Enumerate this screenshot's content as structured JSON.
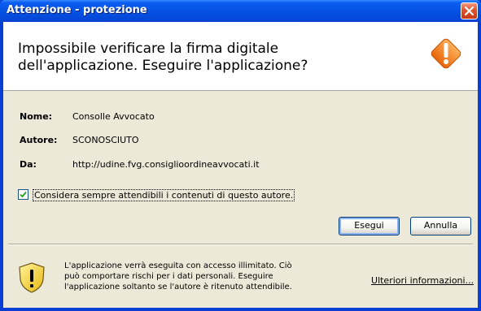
{
  "window": {
    "title": "Attenzione - protezione"
  },
  "header": {
    "message_line1": "Impossibile verificare la firma digitale",
    "message_line2": "dell'applicazione.  Eseguire l'applicazione?"
  },
  "details": {
    "name_label": "Nome:",
    "name_value": "Consolle Avvocato",
    "author_label": "Autore:",
    "author_value": "SCONOSCIUTO",
    "from_label": "Da:",
    "from_value": "http://udine.fvg.consiglioordineavvocati.it"
  },
  "checkbox": {
    "label": "Considera sempre attendibili i contenuti di questo autore.",
    "checked": true
  },
  "buttons": {
    "run": "Esegui",
    "cancel": "Annulla"
  },
  "footer": {
    "message": "L'applicazione verrà eseguita con accesso illimitato. Ciò può comportare rischi per i dati personali. Eseguire l'applicazione soltanto se l'autore è ritenuto attendibile.",
    "more_info_first": "U",
    "more_info_rest": "lteriori informazioni..."
  },
  "icons": {
    "title_close": "close-icon",
    "header_warning": "warning-diamond-icon",
    "footer_warning": "shield-warning-icon",
    "checkbox_check": "checkmark-icon"
  },
  "colors": {
    "titlebar": "#0552e4",
    "client": "#ece9d8",
    "warning_orange": "#f5811f",
    "shield_yellow": "#f4d430"
  }
}
